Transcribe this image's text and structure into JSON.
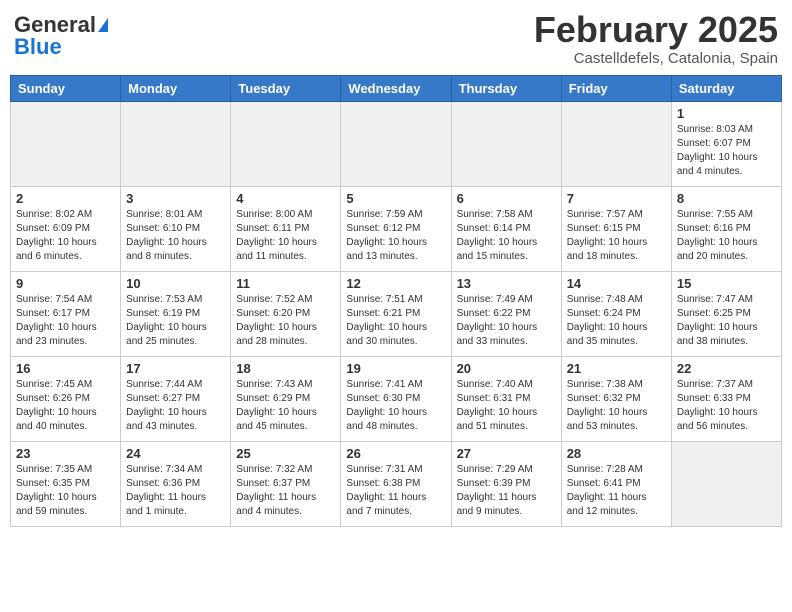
{
  "header": {
    "logo_general": "General",
    "logo_blue": "Blue",
    "month_year": "February 2025",
    "location": "Castelldefels, Catalonia, Spain"
  },
  "weekdays": [
    "Sunday",
    "Monday",
    "Tuesday",
    "Wednesday",
    "Thursday",
    "Friday",
    "Saturday"
  ],
  "weeks": [
    [
      {
        "day": "",
        "empty": true
      },
      {
        "day": "",
        "empty": true
      },
      {
        "day": "",
        "empty": true
      },
      {
        "day": "",
        "empty": true
      },
      {
        "day": "",
        "empty": true
      },
      {
        "day": "",
        "empty": true
      },
      {
        "day": "1",
        "sunrise": "Sunrise: 8:03 AM",
        "sunset": "Sunset: 6:07 PM",
        "daylight": "Daylight: 10 hours and 4 minutes."
      }
    ],
    [
      {
        "day": "2",
        "sunrise": "Sunrise: 8:02 AM",
        "sunset": "Sunset: 6:09 PM",
        "daylight": "Daylight: 10 hours and 6 minutes."
      },
      {
        "day": "3",
        "sunrise": "Sunrise: 8:01 AM",
        "sunset": "Sunset: 6:10 PM",
        "daylight": "Daylight: 10 hours and 8 minutes."
      },
      {
        "day": "4",
        "sunrise": "Sunrise: 8:00 AM",
        "sunset": "Sunset: 6:11 PM",
        "daylight": "Daylight: 10 hours and 11 minutes."
      },
      {
        "day": "5",
        "sunrise": "Sunrise: 7:59 AM",
        "sunset": "Sunset: 6:12 PM",
        "daylight": "Daylight: 10 hours and 13 minutes."
      },
      {
        "day": "6",
        "sunrise": "Sunrise: 7:58 AM",
        "sunset": "Sunset: 6:14 PM",
        "daylight": "Daylight: 10 hours and 15 minutes."
      },
      {
        "day": "7",
        "sunrise": "Sunrise: 7:57 AM",
        "sunset": "Sunset: 6:15 PM",
        "daylight": "Daylight: 10 hours and 18 minutes."
      },
      {
        "day": "8",
        "sunrise": "Sunrise: 7:55 AM",
        "sunset": "Sunset: 6:16 PM",
        "daylight": "Daylight: 10 hours and 20 minutes."
      }
    ],
    [
      {
        "day": "9",
        "sunrise": "Sunrise: 7:54 AM",
        "sunset": "Sunset: 6:17 PM",
        "daylight": "Daylight: 10 hours and 23 minutes."
      },
      {
        "day": "10",
        "sunrise": "Sunrise: 7:53 AM",
        "sunset": "Sunset: 6:19 PM",
        "daylight": "Daylight: 10 hours and 25 minutes."
      },
      {
        "day": "11",
        "sunrise": "Sunrise: 7:52 AM",
        "sunset": "Sunset: 6:20 PM",
        "daylight": "Daylight: 10 hours and 28 minutes."
      },
      {
        "day": "12",
        "sunrise": "Sunrise: 7:51 AM",
        "sunset": "Sunset: 6:21 PM",
        "daylight": "Daylight: 10 hours and 30 minutes."
      },
      {
        "day": "13",
        "sunrise": "Sunrise: 7:49 AM",
        "sunset": "Sunset: 6:22 PM",
        "daylight": "Daylight: 10 hours and 33 minutes."
      },
      {
        "day": "14",
        "sunrise": "Sunrise: 7:48 AM",
        "sunset": "Sunset: 6:24 PM",
        "daylight": "Daylight: 10 hours and 35 minutes."
      },
      {
        "day": "15",
        "sunrise": "Sunrise: 7:47 AM",
        "sunset": "Sunset: 6:25 PM",
        "daylight": "Daylight: 10 hours and 38 minutes."
      }
    ],
    [
      {
        "day": "16",
        "sunrise": "Sunrise: 7:45 AM",
        "sunset": "Sunset: 6:26 PM",
        "daylight": "Daylight: 10 hours and 40 minutes."
      },
      {
        "day": "17",
        "sunrise": "Sunrise: 7:44 AM",
        "sunset": "Sunset: 6:27 PM",
        "daylight": "Daylight: 10 hours and 43 minutes."
      },
      {
        "day": "18",
        "sunrise": "Sunrise: 7:43 AM",
        "sunset": "Sunset: 6:29 PM",
        "daylight": "Daylight: 10 hours and 45 minutes."
      },
      {
        "day": "19",
        "sunrise": "Sunrise: 7:41 AM",
        "sunset": "Sunset: 6:30 PM",
        "daylight": "Daylight: 10 hours and 48 minutes."
      },
      {
        "day": "20",
        "sunrise": "Sunrise: 7:40 AM",
        "sunset": "Sunset: 6:31 PM",
        "daylight": "Daylight: 10 hours and 51 minutes."
      },
      {
        "day": "21",
        "sunrise": "Sunrise: 7:38 AM",
        "sunset": "Sunset: 6:32 PM",
        "daylight": "Daylight: 10 hours and 53 minutes."
      },
      {
        "day": "22",
        "sunrise": "Sunrise: 7:37 AM",
        "sunset": "Sunset: 6:33 PM",
        "daylight": "Daylight: 10 hours and 56 minutes."
      }
    ],
    [
      {
        "day": "23",
        "sunrise": "Sunrise: 7:35 AM",
        "sunset": "Sunset: 6:35 PM",
        "daylight": "Daylight: 10 hours and 59 minutes."
      },
      {
        "day": "24",
        "sunrise": "Sunrise: 7:34 AM",
        "sunset": "Sunset: 6:36 PM",
        "daylight": "Daylight: 11 hours and 1 minute."
      },
      {
        "day": "25",
        "sunrise": "Sunrise: 7:32 AM",
        "sunset": "Sunset: 6:37 PM",
        "daylight": "Daylight: 11 hours and 4 minutes."
      },
      {
        "day": "26",
        "sunrise": "Sunrise: 7:31 AM",
        "sunset": "Sunset: 6:38 PM",
        "daylight": "Daylight: 11 hours and 7 minutes."
      },
      {
        "day": "27",
        "sunrise": "Sunrise: 7:29 AM",
        "sunset": "Sunset: 6:39 PM",
        "daylight": "Daylight: 11 hours and 9 minutes."
      },
      {
        "day": "28",
        "sunrise": "Sunrise: 7:28 AM",
        "sunset": "Sunset: 6:41 PM",
        "daylight": "Daylight: 11 hours and 12 minutes."
      },
      {
        "day": "",
        "empty": true
      }
    ]
  ]
}
